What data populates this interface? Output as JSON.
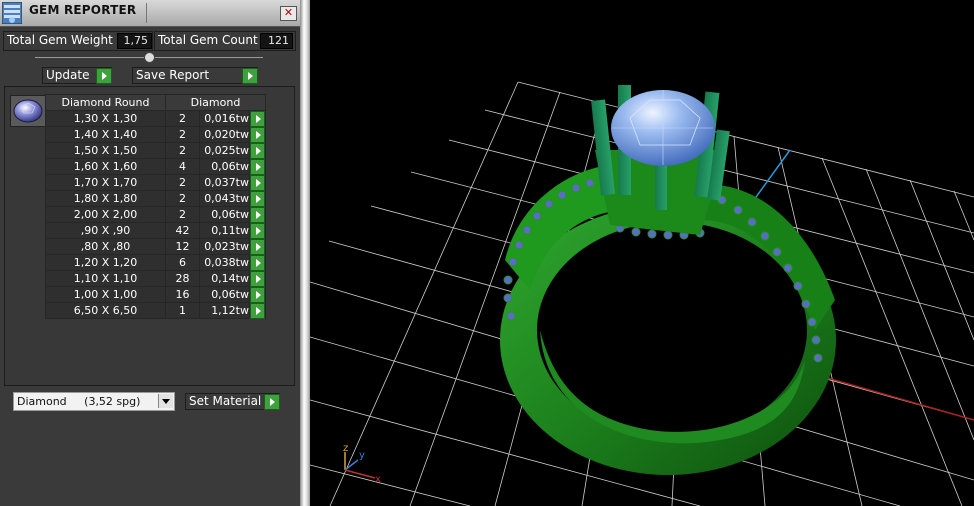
{
  "panel": {
    "title": "GEM REPORTER",
    "close_glyph": "✕",
    "total_weight_label": "Total Gem Weight",
    "total_weight_value": "1,75",
    "total_count_label": "Total Gem Count",
    "total_count_value": "121",
    "update_label": "Update",
    "save_report_label": "Save Report",
    "col_shape": "Diamond Round",
    "col_material": "Diamond",
    "rows": [
      {
        "size": "1,30 X 1,30",
        "count": "2",
        "weight": "0,016tw"
      },
      {
        "size": "1,40 X 1,40",
        "count": "2",
        "weight": "0,020tw"
      },
      {
        "size": "1,50 X 1,50",
        "count": "2",
        "weight": "0,025tw"
      },
      {
        "size": "1,60 X 1,60",
        "count": "4",
        "weight": "0,06tw"
      },
      {
        "size": "1,70 X 1,70",
        "count": "2",
        "weight": "0,037tw"
      },
      {
        "size": "1,80 X 1,80",
        "count": "2",
        "weight": "0,043tw"
      },
      {
        "size": "2,00 X 2,00",
        "count": "2",
        "weight": "0,06tw"
      },
      {
        "size": ",90 X ,90",
        "count": "42",
        "weight": "0,11tw"
      },
      {
        "size": ",80 X ,80",
        "count": "12",
        "weight": "0,023tw"
      },
      {
        "size": "1,20 X 1,20",
        "count": "6",
        "weight": "0,038tw"
      },
      {
        "size": "1,10 X 1,10",
        "count": "28",
        "weight": "0,14tw"
      },
      {
        "size": "1,00 X 1,00",
        "count": "16",
        "weight": "0,06tw"
      },
      {
        "size": "6,50 X 6,50",
        "count": "1",
        "weight": "1,12tw"
      }
    ],
    "material_select": "Diamond     (3,52 spg)",
    "set_material_label": "Set Material"
  },
  "viewport": {
    "axis_x": "x",
    "axis_y": "y",
    "axis_z": "z"
  },
  "colors": {
    "panel_bg": "#3a3a3a",
    "accent_green": "#3ea13e",
    "ring_metal": "#1f8a1f",
    "gem_blue": "#7fa7e8",
    "grid": "#d0d0d0",
    "x_axis": "#b22020",
    "y_axis": "#2a9ad6"
  }
}
